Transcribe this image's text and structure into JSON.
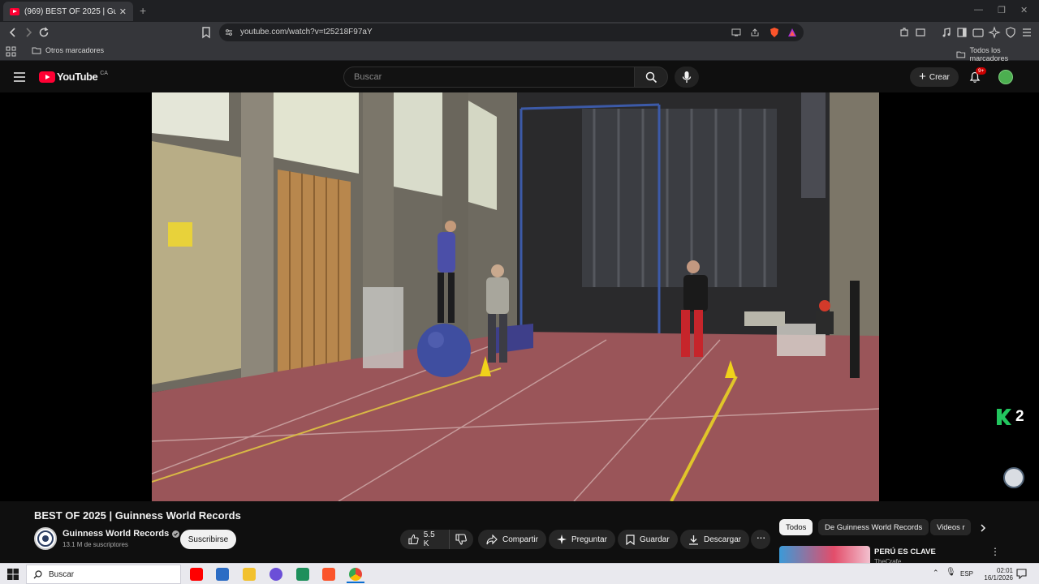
{
  "browser": {
    "tab_title": "(969) BEST OF 2025 | Guinness W",
    "url": "youtube.com/watch?v=t25218F97aY",
    "bookmarks_left": "Otros marcadores",
    "bookmarks_right": "Todos los marcadores"
  },
  "youtube": {
    "logo_text": "YouTube",
    "region": "CA",
    "search_placeholder": "Buscar",
    "create_label": "Crear",
    "notif_count": "9+"
  },
  "video": {
    "title": "BEST OF 2025 | Guinness World Records",
    "overlay_badge": "2",
    "channel_name": "Guinness World Records",
    "subscribers": "13.1 M de suscriptores",
    "subscribe_label": "Suscribirse",
    "likes": "5.5 K",
    "share_label": "Compartir",
    "ask_label": "Preguntar",
    "save_label": "Guardar",
    "download_label": "Descargar"
  },
  "sidebar": {
    "chips": [
      "Todos",
      "De Guinness World Records",
      "Videos r"
    ],
    "recommendation_title": "PERÚ ES CLAVE",
    "recommendation_channel": "TheCrafe"
  },
  "taskbar": {
    "search_label": "Buscar",
    "lang": "ESP",
    "time": "02:01",
    "date": "16/1/2026"
  },
  "colors": {
    "accent_red": "#ff0033",
    "k_badge_green": "#22c55e"
  }
}
